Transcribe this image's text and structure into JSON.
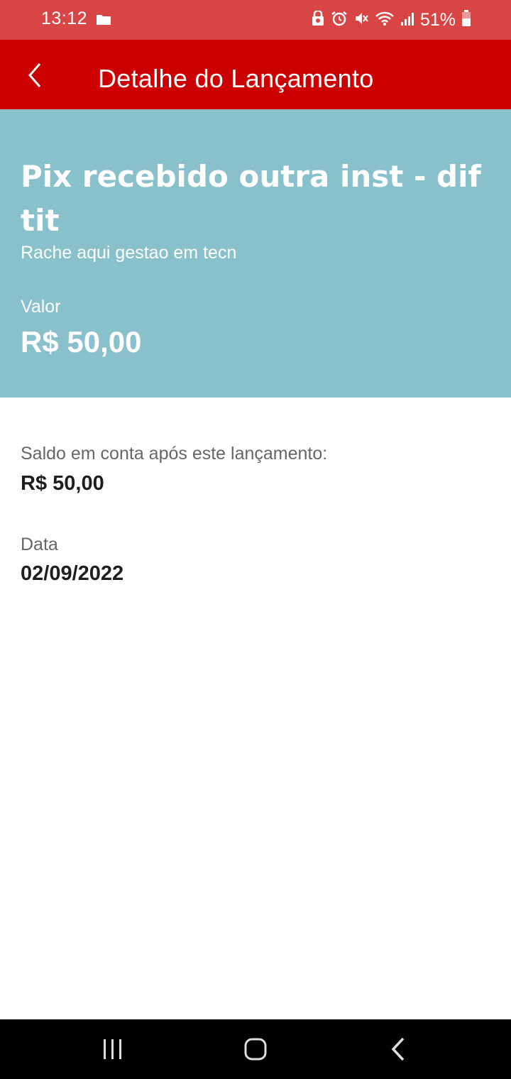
{
  "status_bar": {
    "time": "13:12",
    "battery": "51%",
    "icons": [
      "folder-icon",
      "vpn-icon",
      "alarm-icon",
      "mute-icon",
      "wifi-icon",
      "signal-icon",
      "battery-icon"
    ]
  },
  "app_bar": {
    "title": "Detalhe do Lançamento",
    "back_icon": "back-arrow-icon",
    "color": "#cc0000"
  },
  "transaction": {
    "title": "Pix recebido outra inst - dif tit",
    "subtitle": "Rache aqui gestao em tecn",
    "value_label": "Valor",
    "value": "R$ 50,00",
    "background_color": "#88c0cc"
  },
  "details": {
    "balance_label": "Saldo em conta após este lançamento:",
    "balance_value": "R$ 50,00",
    "date_label": "Data",
    "date_value": "02/09/2022"
  },
  "nav_bar": {
    "icons": [
      "recent-apps-icon",
      "home-icon",
      "back-icon"
    ]
  }
}
